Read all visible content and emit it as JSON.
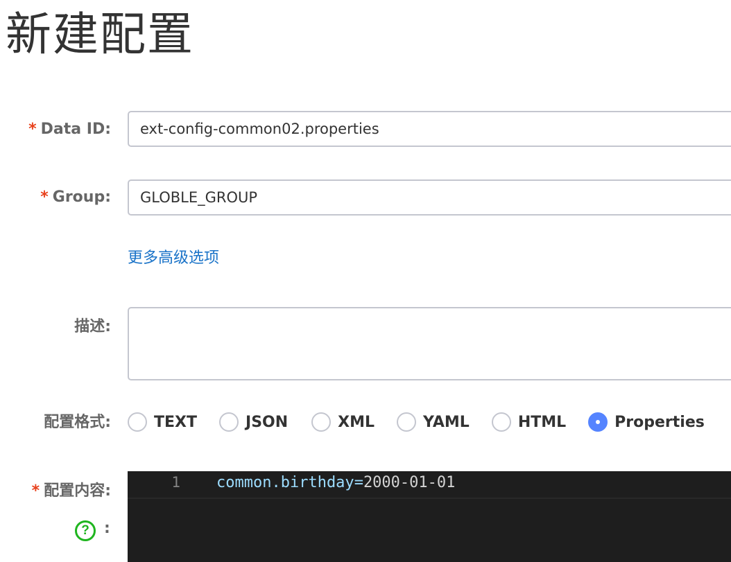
{
  "page": {
    "title": "新建配置"
  },
  "form": {
    "data_id": {
      "label": "Data ID:",
      "required": "*",
      "value": "ext-config-common02.properties"
    },
    "group": {
      "label": "Group:",
      "required": "*",
      "value": "GLOBLE_GROUP"
    },
    "advanced_link": "更多高级选项",
    "description": {
      "label": "描述:",
      "value": ""
    },
    "format": {
      "label": "配置格式:",
      "options": [
        "TEXT",
        "JSON",
        "XML",
        "YAML",
        "HTML",
        "Properties"
      ],
      "selected": "Properties"
    },
    "content": {
      "label": "配置内容:",
      "required": "*",
      "help_icon": "question-circle-icon",
      "help_colon": ":",
      "lines": [
        {
          "number": "1",
          "key": "common.birthday",
          "eq": "=",
          "value": "2000-01-01"
        }
      ]
    }
  },
  "colors": {
    "required": "#e8411c",
    "link": "#1a73c8",
    "radio_checked": "#5584ff",
    "help_icon": "#1fb51f",
    "editor_bg": "#1e1e1e",
    "code_key": "#9cdcfe"
  }
}
